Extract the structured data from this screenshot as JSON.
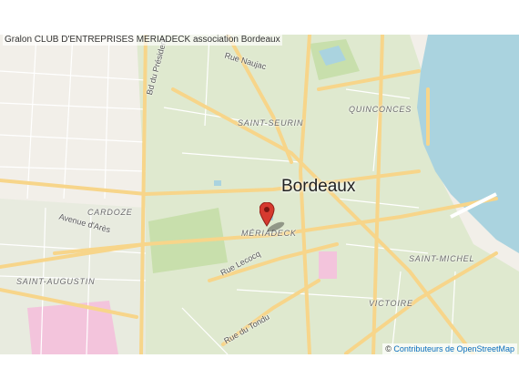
{
  "title": "Gralon CLUB D'ENTREPRISES MERIADECK association Bordeaux",
  "map": {
    "city": "Bordeaux",
    "districts": [
      "QUINCONCES",
      "SAINT-SEURIN",
      "CARDOZE",
      "MÉRIADECK",
      "SAINT-MICHEL",
      "SAINT-AUGUSTIN",
      "VICTOIRE"
    ],
    "roads": [
      "Rue Naujac",
      "Bd du Président",
      "Avenue d'Arès",
      "Rue Lecocq",
      "Rue du Tondu"
    ],
    "attribution": {
      "symbol": "©",
      "text": "Contributeurs de OpenStreetMap"
    },
    "colors": {
      "urban": "#dfe9cf",
      "background": "#f2efe9",
      "water": "#aad3df",
      "road": "#f7d58a",
      "park": "#c8dfac",
      "marker": "#d63a2f"
    }
  }
}
